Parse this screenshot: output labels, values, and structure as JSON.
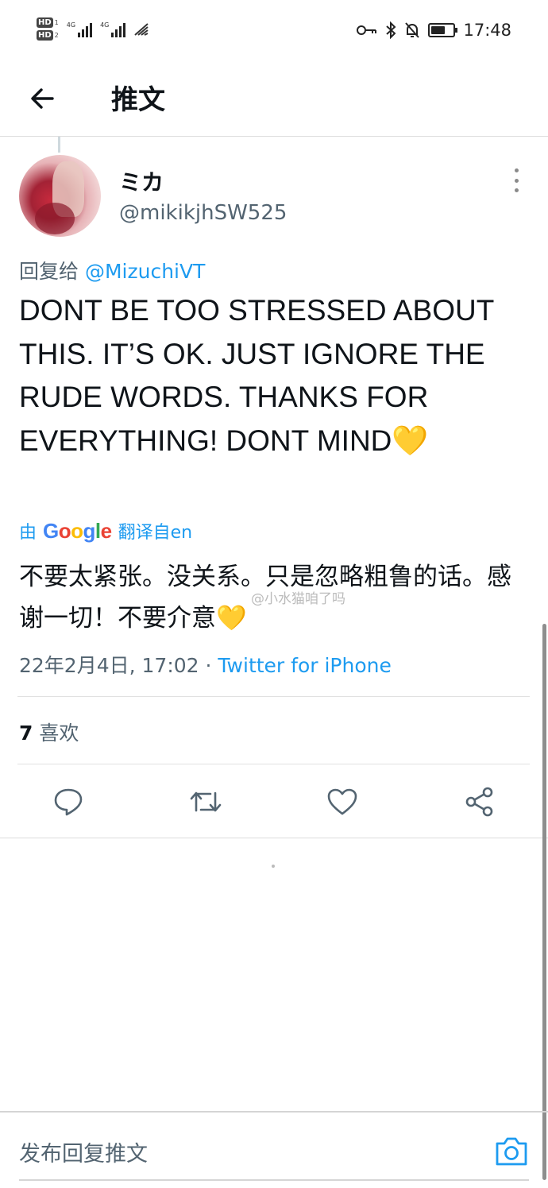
{
  "status_bar": {
    "hd1": "HD",
    "hd1_n": "1",
    "hd2": "HD",
    "hd2_n": "2",
    "net1": "4G",
    "net2": "4G",
    "time": "17:48",
    "battery_level": 0.65
  },
  "header": {
    "title": "推文",
    "back_icon": "arrow-left-icon"
  },
  "tweet": {
    "author_name": "ミカ",
    "author_handle": "@mikikjhSW525",
    "reply_prefix": "回复给",
    "reply_mention": "@MizuchiVT",
    "text": "DONT BE TOO STRESSED ABOUT THIS. IT’S OK. JUST IGNORE THE RUDE WORDS. THANKS FOR EVERYTHING! DONT MIND",
    "emoji": "💛",
    "translate_prefix": "由",
    "translate_provider": "Google",
    "translate_suffix": "翻译自en",
    "translated_text": "不要太紧张。没关系。只是忽略粗鲁的话。感谢一切！不要介意",
    "watermark": "@小水猫咱了吗",
    "timestamp": "22年2月4日, 17:02",
    "separator": " · ",
    "source": "Twitter for iPhone",
    "likes_count": "7",
    "likes_label": "喜欢"
  },
  "actions": {
    "reply_icon": "comment-icon",
    "retweet_icon": "retweet-icon",
    "like_icon": "heart-icon",
    "share_icon": "share-icon"
  },
  "compose": {
    "placeholder": "发布回复推文",
    "camera_icon": "camera-icon"
  },
  "colors": {
    "accent": "#1d9bf0",
    "text": "#0f1419",
    "muted": "#536471"
  }
}
